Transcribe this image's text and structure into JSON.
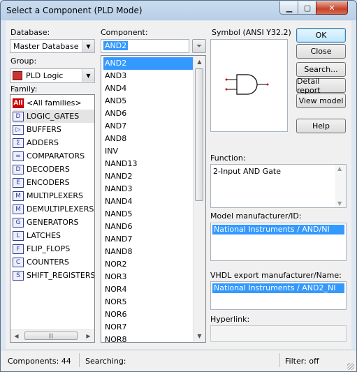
{
  "window": {
    "title": "Select a Component (PLD Mode)"
  },
  "database": {
    "label": "Database:",
    "value": "Master Database"
  },
  "group": {
    "label": "Group:",
    "value": "PLD Logic"
  },
  "family": {
    "label": "Family:",
    "items": [
      {
        "label": "<All families>",
        "icon": "all-families-icon",
        "icon_text": "All"
      },
      {
        "label": "LOGIC_GATES",
        "icon": "logic-gate-icon",
        "icon_text": "D"
      },
      {
        "label": "BUFFERS",
        "icon": "buffer-icon",
        "icon_text": "▷"
      },
      {
        "label": "ADDERS",
        "icon": "adder-icon",
        "icon_text": "Σ"
      },
      {
        "label": "COMPARATORS",
        "icon": "comparator-icon",
        "icon_text": "="
      },
      {
        "label": "DECODERS",
        "icon": "decoder-icon",
        "icon_text": "D"
      },
      {
        "label": "ENCODERS",
        "icon": "encoder-icon",
        "icon_text": "E"
      },
      {
        "label": "MULTIPLEXERS",
        "icon": "multiplexer-icon",
        "icon_text": "M"
      },
      {
        "label": "DEMULTIPLEXERS",
        "icon": "demultiplexer-icon",
        "icon_text": "M"
      },
      {
        "label": "GENERATORS",
        "icon": "generator-icon",
        "icon_text": "G"
      },
      {
        "label": "LATCHES",
        "icon": "latch-icon",
        "icon_text": "L"
      },
      {
        "label": "FLIP_FLOPS",
        "icon": "flip-flop-icon",
        "icon_text": "F"
      },
      {
        "label": "COUNTERS",
        "icon": "counter-icon",
        "icon_text": "C"
      },
      {
        "label": "SHIFT_REGISTERS",
        "icon": "shift-register-icon",
        "icon_text": "S"
      }
    ],
    "selected": "LOGIC_GATES"
  },
  "component": {
    "label": "Component:",
    "search_value": "AND2",
    "items": [
      "AND2",
      "AND3",
      "AND4",
      "AND5",
      "AND6",
      "AND7",
      "AND8",
      "INV",
      "NAND13",
      "NAND2",
      "NAND3",
      "NAND4",
      "NAND5",
      "NAND6",
      "NAND7",
      "NAND8",
      "NOR2",
      "NOR3",
      "NOR4",
      "NOR5",
      "NOR6",
      "NOR7",
      "NOR8"
    ],
    "selected": "AND2"
  },
  "symbol": {
    "label": "Symbol (ANSI Y32.2)"
  },
  "buttons": {
    "ok": "OK",
    "close": "Close",
    "search": "Search...",
    "detail_report": "Detail report",
    "view_model": "View model",
    "help": "Help"
  },
  "function": {
    "label": "Function:",
    "value": "2-Input AND Gate"
  },
  "model": {
    "label": "Model manufacturer/ID:",
    "value": "National Instruments / AND/NI"
  },
  "vhdl": {
    "label": "VHDL export manufacturer/Name:",
    "value": "National Instruments / AND2_NI"
  },
  "hyperlink": {
    "label": "Hyperlink:",
    "value": ""
  },
  "status": {
    "components": "Components: 44",
    "searching": "Searching:",
    "filter": "Filter: off"
  }
}
